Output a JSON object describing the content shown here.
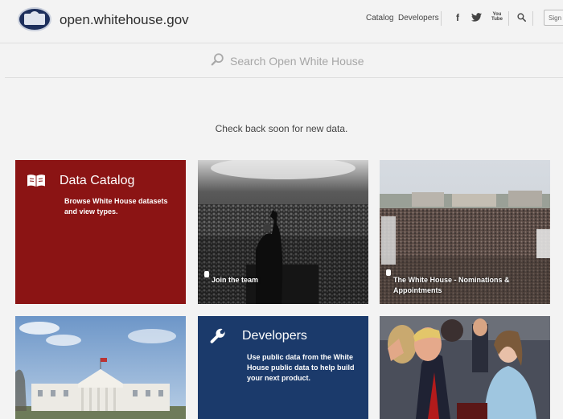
{
  "header": {
    "site_name": "open.whitehouse.gov",
    "nav": {
      "catalog": "Catalog",
      "developers": "Developers"
    },
    "social": {
      "facebook": "f",
      "twitter": "t",
      "youtube": "You Tube"
    },
    "sign_in": "Sign In"
  },
  "search": {
    "placeholder": "Search Open White House"
  },
  "notice": "Check back soon for new data.",
  "tiles": {
    "data_catalog": {
      "title": "Data Catalog",
      "description": "Browse White House datasets and view types.",
      "color": "#8b1414"
    },
    "join_team": {
      "caption": "Join the team"
    },
    "nominations": {
      "caption": "The White House - Nominations & Appointments"
    },
    "developers": {
      "title": "Developers",
      "description": "Use public data from the White House public data to help build your next product.",
      "color": "#1b3a6b"
    }
  }
}
